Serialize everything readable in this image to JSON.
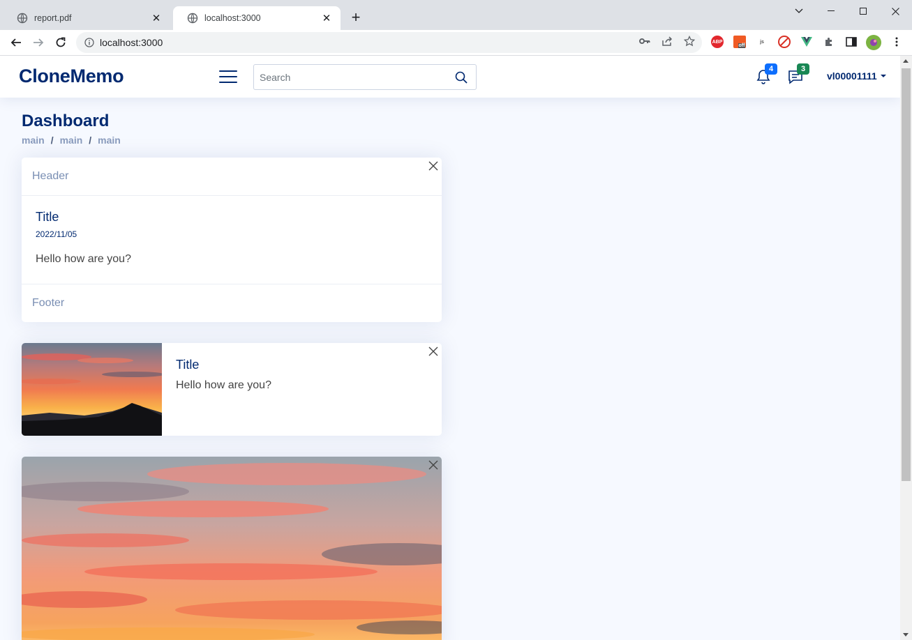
{
  "browser": {
    "tabs": [
      {
        "title": "report.pdf",
        "active": false
      },
      {
        "title": "localhost:3000",
        "active": true
      }
    ],
    "url": "localhost:3000",
    "extensions": [
      "ABP",
      "off",
      "js"
    ]
  },
  "app": {
    "brand": "CloneMemo",
    "search": {
      "placeholder": "Search",
      "value": ""
    },
    "notifications": {
      "count": "4"
    },
    "messages": {
      "count": "3"
    },
    "user": "vl00001111",
    "colors": {
      "primary": "#012970",
      "accent": "#4154f1",
      "notif_badge": "#0d6efd",
      "msg_badge": "#198754",
      "bg": "#f6f9ff"
    }
  },
  "page": {
    "title": "Dashboard",
    "breadcrumb": [
      "main",
      "main",
      "main"
    ]
  },
  "cards": [
    {
      "header": "Header",
      "title": "Title",
      "date": "2022/11/05",
      "text": "Hello how are you?",
      "footer": "Footer"
    },
    {
      "title": "Title",
      "text": "Hello how are you?",
      "image": "sunset-mountain"
    },
    {
      "image": "sunset-sky"
    }
  ]
}
